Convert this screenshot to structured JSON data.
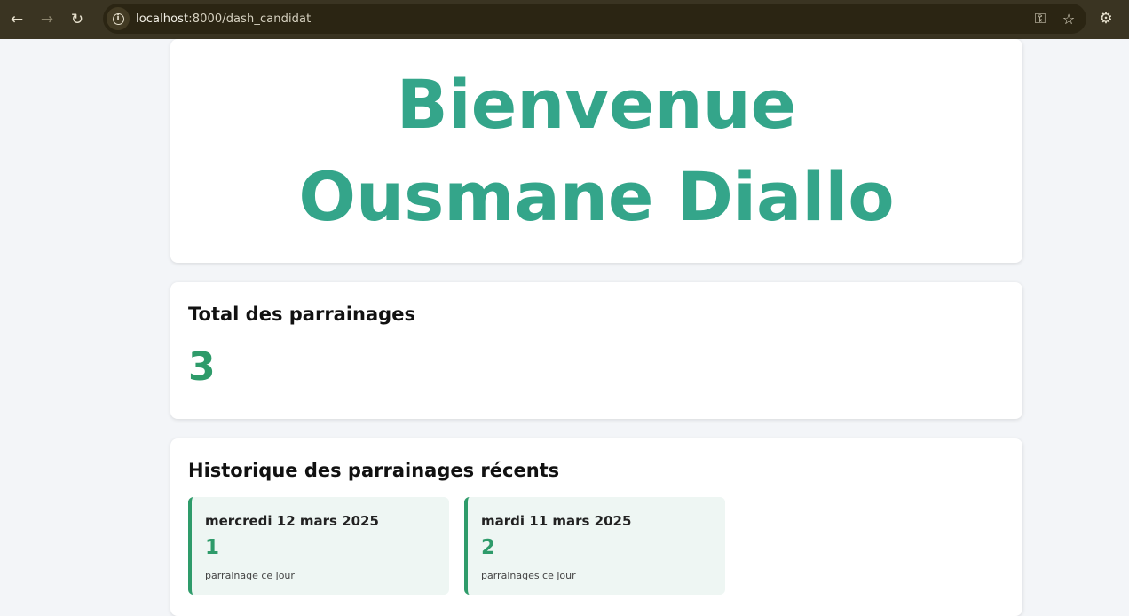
{
  "browser": {
    "url_host": "localhost",
    "url_rest": ":8000/dash_candidat",
    "icons": [
      "back-icon",
      "forward-icon",
      "reload-icon",
      "info-icon",
      "key-icon",
      "star-icon",
      "extensions-icon"
    ]
  },
  "welcome": {
    "title": "Bienvenue Ousmane Diallo"
  },
  "total": {
    "heading": "Total des parrainages",
    "value": "3"
  },
  "history": {
    "heading": "Historique des parrainages récents",
    "days": [
      {
        "date": "mercredi 12 mars 2025",
        "count": "1",
        "label": "parrainage ce jour"
      },
      {
        "date": "mardi 11 mars 2025",
        "count": "2",
        "label": "parrainages ce jour"
      }
    ]
  },
  "colors": {
    "accent": "#34a58a",
    "green": "#2e9b6a",
    "chrome": "#3a3422"
  }
}
